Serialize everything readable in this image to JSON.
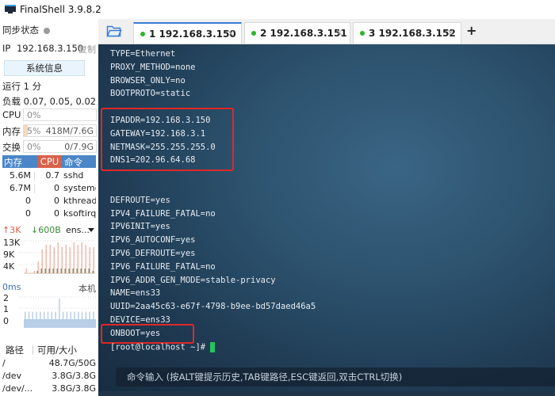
{
  "app": {
    "title": "FinalShell 3.9.8.2"
  },
  "sidebar": {
    "sync_label": "同步状态",
    "ip_label": "IP",
    "ip_value": "192.168.3.150",
    "copy_label": "复制",
    "sysinfo_button": "系统信息",
    "uptime": "运行 1 分",
    "load": "负载 0.07, 0.05, 0.02",
    "meters": {
      "cpu": {
        "label": "CPU",
        "percent_text": "0%",
        "percent": 0,
        "value": ""
      },
      "mem": {
        "label": "内存",
        "percent_text": "5%",
        "percent": 5,
        "value": "418M/7.6G"
      },
      "swap": {
        "label": "交换",
        "percent_text": "0%",
        "percent": 0,
        "value": "0/7.9G"
      }
    },
    "process_table": {
      "headers": {
        "mem": "内存",
        "cpu": "CPU",
        "cmd": "命令"
      },
      "rows": [
        {
          "mem": "5.6M",
          "cpu": "0.7",
          "cmd": "sshd"
        },
        {
          "mem": "6.7M",
          "cpu": "0",
          "cmd": "systemd"
        },
        {
          "mem": "0",
          "cpu": "0",
          "cmd": "kthreadd"
        },
        {
          "mem": "0",
          "cpu": "0",
          "cmd": "ksoftirqd"
        }
      ]
    },
    "network": {
      "upload": "↑3K",
      "download": "↓600B",
      "interface": "ens...",
      "y_labels": [
        "13K",
        "9K",
        "4K"
      ],
      "colors": {
        "upload": "#f3b9a8",
        "download": "#8a8a6a"
      },
      "upload_series": [
        2,
        0,
        1,
        5,
        10,
        12,
        12,
        11,
        13,
        11,
        12,
        11,
        13,
        12,
        13,
        12,
        11,
        11
      ],
      "download_series": [
        0,
        0,
        0,
        1,
        2,
        2,
        2,
        2,
        2,
        2,
        2,
        2,
        2,
        2,
        2,
        2,
        2,
        1
      ]
    },
    "ping": {
      "latency": "0ms",
      "host": "本机",
      "y_labels": [
        "2",
        "1",
        "0"
      ],
      "color": "#b9cfe8",
      "series": [
        1,
        1,
        1,
        1,
        1,
        1,
        1,
        1,
        1,
        2,
        1,
        1,
        1,
        1,
        1,
        1,
        1,
        1,
        1
      ]
    },
    "disk_table": {
      "headers": {
        "path": "路径",
        "avail": "可用/大小"
      },
      "rows": [
        {
          "path": "/",
          "avail": "48.7G/50G"
        },
        {
          "path": "/dev",
          "avail": "3.8G/3.8G"
        },
        {
          "path": "/dev/...",
          "avail": "3.8G/3.8G"
        }
      ]
    }
  },
  "tabs": [
    {
      "label": "1 192.168.3.150",
      "active": true,
      "status_color": "#2db42d"
    },
    {
      "label": "2 192.168.3.151",
      "active": false,
      "status_color": "#2db42d"
    },
    {
      "label": "3 192.168.3.152",
      "active": false,
      "status_color": "#2db42d"
    }
  ],
  "tab_close_glyph": "×",
  "add_tab_glyph": "+",
  "terminal": {
    "lines": [
      "TYPE=Ethernet",
      "PROXY_METHOD=none",
      "BROWSER_ONLY=no",
      "BOOTPROTO=static",
      "",
      "IPADDR=192.168.3.150",
      "GATEWAY=192.168.3.1",
      "NETMASK=255.255.255.0",
      "DNS1=202.96.64.68",
      "",
      "",
      "DEFROUTE=yes",
      "IPV4_FAILURE_FATAL=no",
      "IPV6INIT=yes",
      "IPV6_AUTOCONF=yes",
      "IPV6_DEFROUTE=yes",
      "IPV6_FAILURE_FATAL=no",
      "IPV6_ADDR_GEN_MODE=stable-privacy",
      "NAME=ens33",
      "UUID=2aa45c63-e67f-4798-b9ee-bd57daed46a5",
      "DEVICE=ens33",
      "ONBOOT=yes"
    ],
    "prompt": "[root@localhost ~]#",
    "highlight_color": "#e02828",
    "cursor_color": "#22c55e"
  },
  "command_bar": {
    "hint": "命令输入 (按ALT键提示历史,TAB键路径,ESC键返回,双击CTRL切换)"
  }
}
